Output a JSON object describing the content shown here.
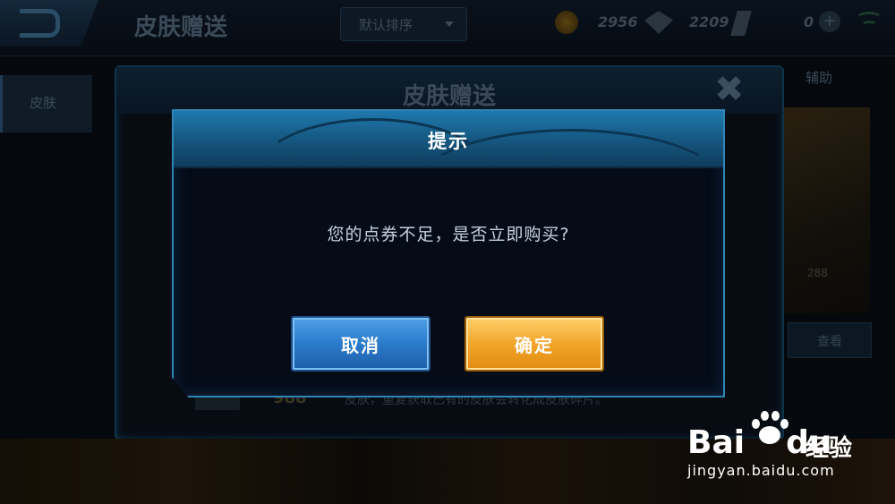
{
  "background": {
    "topbar": {
      "title": "皮肤赠送",
      "sort_dropdown": "默认排序",
      "gold": "2956",
      "gems": "2209",
      "vouchers": "0",
      "plus": "+"
    },
    "side_tab": "皮肤",
    "dialog": {
      "title": "皮肤赠送",
      "close": "✖",
      "help_tab": "辅助",
      "price": "988",
      "desc": "皮肤，重复获取已有的皮肤会转化成皮肤碎片。",
      "view_button": "查看",
      "card_price": "288"
    }
  },
  "modal": {
    "title": "提示",
    "message": "您的点券不足，是否立即购买?",
    "cancel_label": "取消",
    "confirm_label": "确定"
  },
  "watermark": {
    "brand": "Bai",
    "brand_du": "du",
    "brand_cn": "经验",
    "url": "jingyan.baidu.com"
  }
}
